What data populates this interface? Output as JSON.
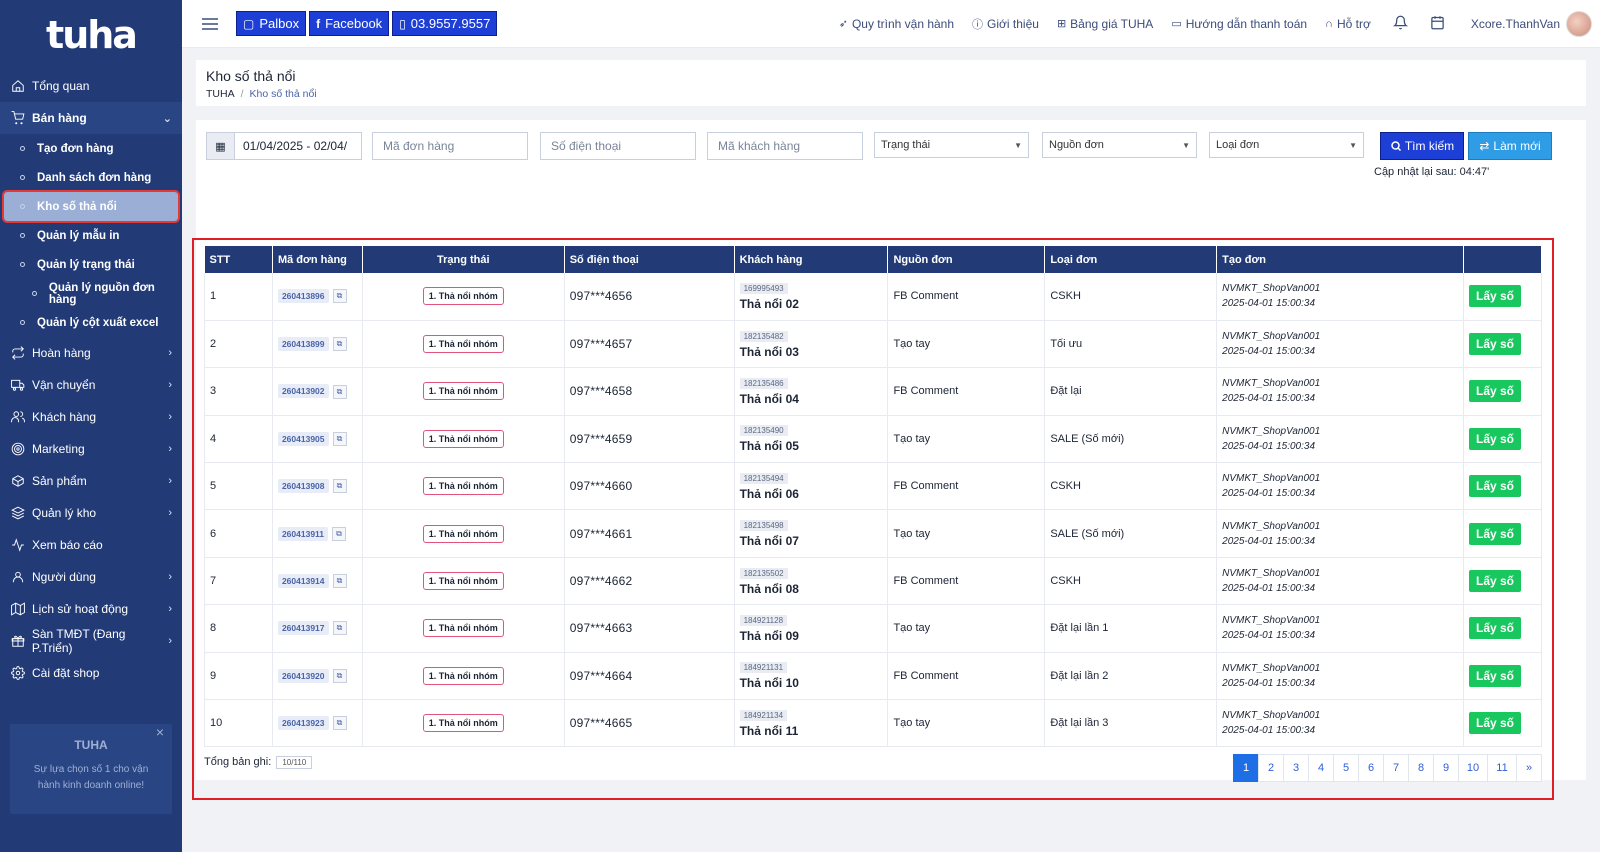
{
  "app": {
    "logo": "tuha"
  },
  "sidebar": {
    "items": [
      {
        "label": "Tổng quan",
        "icon": "home-icon"
      },
      {
        "label": "Bán hàng",
        "icon": "cart-icon",
        "open": true
      }
    ],
    "sub_items": [
      {
        "label": "Tạo đơn hàng"
      },
      {
        "label": "Danh sách đơn hàng"
      },
      {
        "label": "Kho số thả nổi",
        "active": true
      },
      {
        "label": "Quản lý mẫu in"
      },
      {
        "label": "Quản lý trạng thái"
      },
      {
        "label": "Quản lý nguồn đơn hàng",
        "deep": true
      },
      {
        "label": "Quản lý cột xuất excel"
      }
    ],
    "items_after": [
      {
        "label": "Hoàn hàng",
        "icon": "return-icon",
        "chev": true
      },
      {
        "label": "Vận chuyển",
        "icon": "truck-icon",
        "chev": true
      },
      {
        "label": "Khách hàng",
        "icon": "users-icon",
        "chev": true
      },
      {
        "label": "Marketing",
        "icon": "target-icon",
        "chev": true
      },
      {
        "label": "Sản phẩm",
        "icon": "box-icon",
        "chev": true
      },
      {
        "label": "Quản lý kho",
        "icon": "layers-icon",
        "chev": true
      },
      {
        "label": "Xem báo cáo",
        "icon": "activity-icon",
        "chev": false
      },
      {
        "label": "Người dùng",
        "icon": "user-icon",
        "chev": true
      },
      {
        "label": "Lịch sử hoạt động",
        "icon": "map-icon",
        "chev": true
      },
      {
        "label": "Sàn TMĐT (Đang P.Triển)",
        "icon": "gift-icon",
        "chev": true
      },
      {
        "label": "Cài đặt shop",
        "icon": "settings-icon",
        "chev": false
      }
    ],
    "promo": {
      "title": "TUHA",
      "desc": "Sự lựa chọn số 1 cho vận hành kinh doanh online!"
    }
  },
  "topbar": {
    "buttons": [
      {
        "label": "Palbox",
        "icon": "chat-icon"
      },
      {
        "label": "Facebook",
        "icon": "facebook-icon"
      },
      {
        "label": "03.9557.9557",
        "icon": "phone-icon"
      }
    ],
    "links": [
      {
        "label": "Quy trình vận hành",
        "icon": "send-icon"
      },
      {
        "label": "Giới thiệu",
        "icon": "info-icon"
      },
      {
        "label": "Bảng giá TUHA",
        "icon": "gift-icon"
      },
      {
        "label": "Hướng dẫn thanh toán",
        "icon": "card-icon"
      },
      {
        "label": "Hỗ trợ",
        "icon": "headset-icon"
      }
    ],
    "username": "Xcore.ThanhVan"
  },
  "page": {
    "title": "Kho số thả nổi",
    "breadcrumb": [
      "TUHA",
      "Kho số thả nổi"
    ]
  },
  "filters": {
    "date_range": "01/04/2025 - 02/04/",
    "order_code_placeholder": "Mã đơn hàng",
    "phone_placeholder": "Số điện thoại",
    "customer_code_placeholder": "Mã khách hàng",
    "status_select": "Trạng thái",
    "source_select": "Nguồn đơn",
    "type_select": "Loại đơn",
    "search_label": "Tìm kiếm",
    "reset_label": "Làm mới",
    "updated_text": "Cập nhật lại sau: 04:47'"
  },
  "table": {
    "columns": [
      "STT",
      "Mã đơn hàng",
      "Trạng thái",
      "Số điện thoại",
      "Khách hàng",
      "Nguồn đơn",
      "Loại đơn",
      "Tạo đơn",
      ""
    ],
    "action_label": "Lấy số",
    "rows": [
      {
        "stt": "1",
        "code": "260413896",
        "status": "1. Thả nổi nhóm",
        "phone": "097***4656",
        "cust_id": "169995493",
        "cust_name": "Thả nổi 02",
        "source": "FB Comment",
        "type": "CSKH",
        "creator": "NVMKT_ShopVan001",
        "created": "2025-04-01 15:00:34"
      },
      {
        "stt": "2",
        "code": "260413899",
        "status": "1. Thả nổi nhóm",
        "phone": "097***4657",
        "cust_id": "182135482",
        "cust_name": "Thả nổi 03",
        "source": "Tạo tay",
        "type": "Tối ưu",
        "creator": "NVMKT_ShopVan001",
        "created": "2025-04-01 15:00:34"
      },
      {
        "stt": "3",
        "code": "260413902",
        "status": "1. Thả nổi nhóm",
        "phone": "097***4658",
        "cust_id": "182135486",
        "cust_name": "Thả nổi 04",
        "source": "FB Comment",
        "type": "Đặt lại",
        "creator": "NVMKT_ShopVan001",
        "created": "2025-04-01 15:00:34"
      },
      {
        "stt": "4",
        "code": "260413905",
        "status": "1. Thả nổi nhóm",
        "phone": "097***4659",
        "cust_id": "182135490",
        "cust_name": "Thả nổi 05",
        "source": "Tạo tay",
        "type": "SALE (Số mới)",
        "creator": "NVMKT_ShopVan001",
        "created": "2025-04-01 15:00:34"
      },
      {
        "stt": "5",
        "code": "260413908",
        "status": "1. Thả nổi nhóm",
        "phone": "097***4660",
        "cust_id": "182135494",
        "cust_name": "Thả nổi 06",
        "source": "FB Comment",
        "type": "CSKH",
        "creator": "NVMKT_ShopVan001",
        "created": "2025-04-01 15:00:34"
      },
      {
        "stt": "6",
        "code": "260413911",
        "status": "1. Thả nổi nhóm",
        "phone": "097***4661",
        "cust_id": "182135498",
        "cust_name": "Thả nổi 07",
        "source": "Tạo tay",
        "type": "SALE (Số mới)",
        "creator": "NVMKT_ShopVan001",
        "created": "2025-04-01 15:00:34"
      },
      {
        "stt": "7",
        "code": "260413914",
        "status": "1. Thả nổi nhóm",
        "phone": "097***4662",
        "cust_id": "182135502",
        "cust_name": "Thả nổi 08",
        "source": "FB Comment",
        "type": "CSKH",
        "creator": "NVMKT_ShopVan001",
        "created": "2025-04-01 15:00:34"
      },
      {
        "stt": "8",
        "code": "260413917",
        "status": "1. Thả nổi nhóm",
        "phone": "097***4663",
        "cust_id": "184921128",
        "cust_name": "Thả nổi 09",
        "source": "Tạo tay",
        "type": "Đặt lại lần 1",
        "creator": "NVMKT_ShopVan001",
        "created": "2025-04-01 15:00:34"
      },
      {
        "stt": "9",
        "code": "260413920",
        "status": "1. Thả nổi nhóm",
        "phone": "097***4664",
        "cust_id": "184921131",
        "cust_name": "Thả nổi 10",
        "source": "FB Comment",
        "type": "Đặt lại lần 2",
        "creator": "NVMKT_ShopVan001",
        "created": "2025-04-01 15:00:34"
      },
      {
        "stt": "10",
        "code": "260413923",
        "status": "1. Thả nổi nhóm",
        "phone": "097***4665",
        "cust_id": "184921134",
        "cust_name": "Thả nổi 11",
        "source": "Tạo tay",
        "type": "Đặt lại lần 3",
        "creator": "NVMKT_ShopVan001",
        "created": "2025-04-01 15:00:34"
      }
    ]
  },
  "footer": {
    "total_label": "Tổng bản ghi:",
    "total_count": "10/110",
    "pages": [
      "1",
      "2",
      "3",
      "4",
      "5",
      "6",
      "7",
      "8",
      "9",
      "10",
      "11",
      "»"
    ],
    "active_page": "1"
  }
}
